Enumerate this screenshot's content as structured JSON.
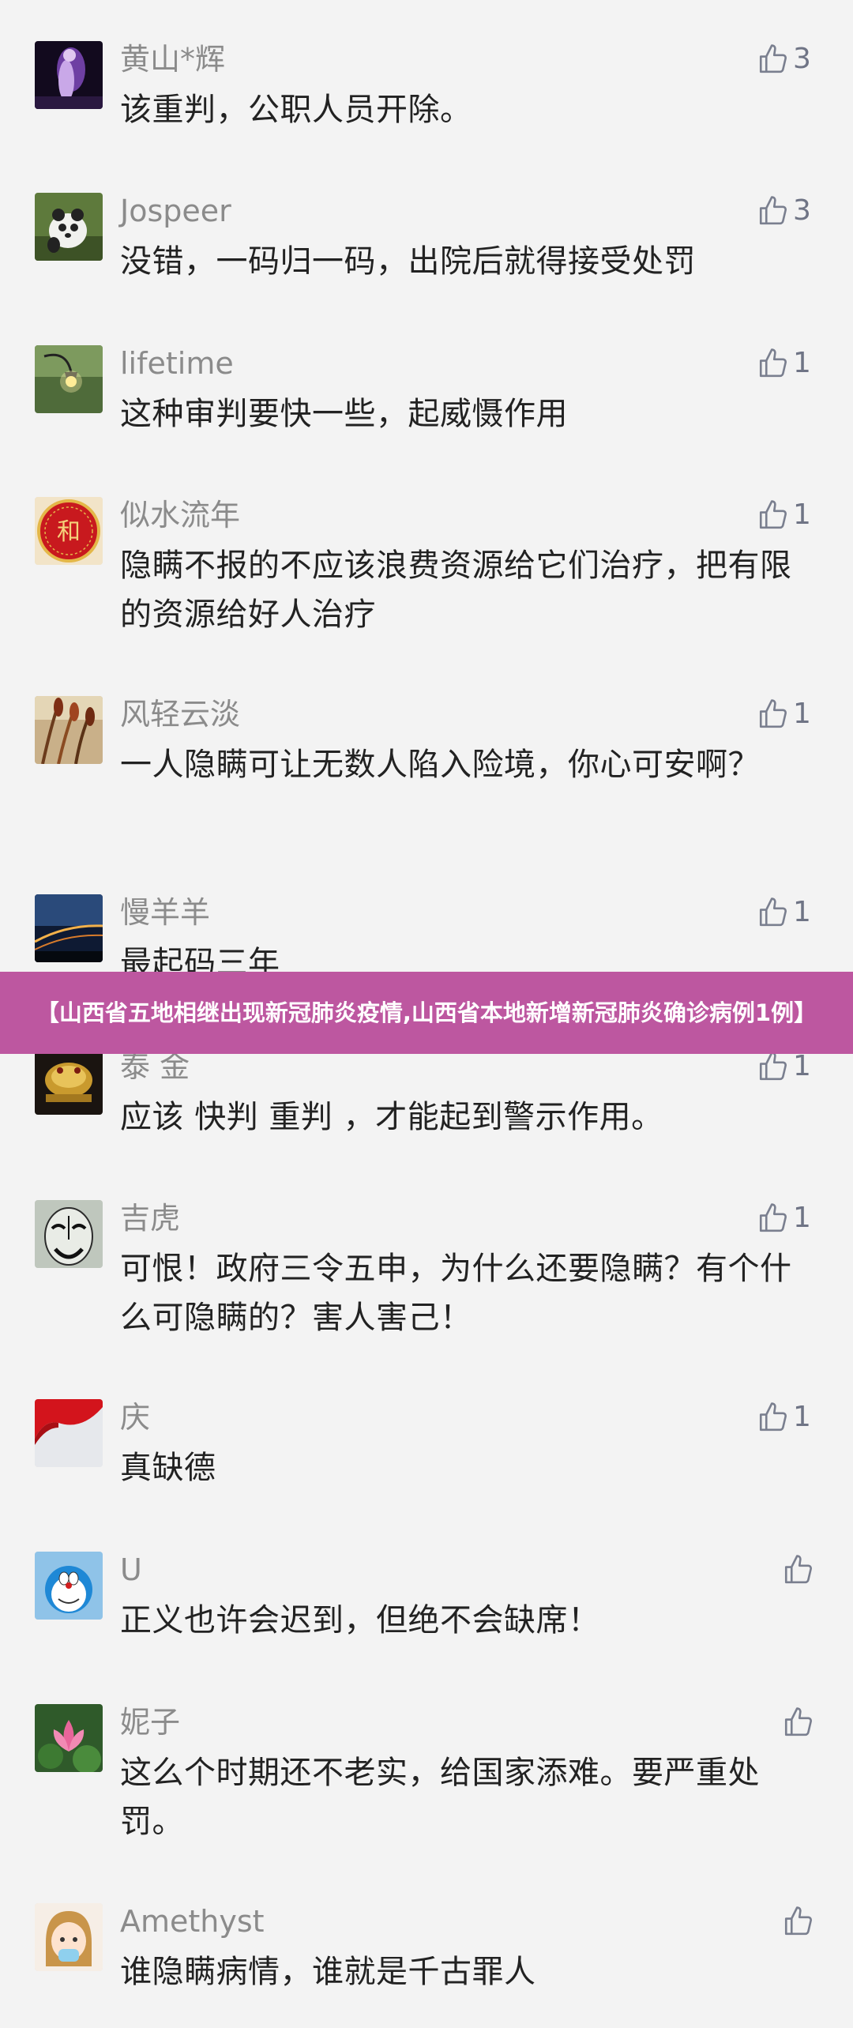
{
  "banner": {
    "title": "【山西省五地相继出现新冠肺炎疫情,山西省本地新增新冠肺炎确诊病例1例】"
  },
  "colors": {
    "background": "#f3f3f3",
    "banner": "#bd57a0",
    "username": "#8b8b8b",
    "comment_text": "#222222",
    "like_icon": "#7a7f8f"
  },
  "comments": [
    {
      "name": "黄山*辉",
      "text": "该重判，公职人员开除。",
      "likes": "3",
      "avatar_icon": "night-figure-avatar"
    },
    {
      "name": "Jospeer",
      "text": "没错，一码归一码，出院后就得接受处罚",
      "likes": "3",
      "avatar_icon": "panda-avatar"
    },
    {
      "name": "lifetime",
      "text": "这种审判要快一些，起威慑作用",
      "likes": "1",
      "avatar_icon": "street-lamp-avatar"
    },
    {
      "name": "似水流年",
      "text": "隐瞒不报的不应该浪费资源给它们治疗，把有限的资源给好人治疗",
      "likes": "1",
      "avatar_icon": "he-character-avatar"
    },
    {
      "name": "风轻云淡",
      "text": "一人隐瞒可让无数人陷入险境，你心可安啊？",
      "likes": "1",
      "avatar_icon": "reeds-avatar"
    },
    {
      "name": "慢羊羊",
      "text": "最起码三年",
      "likes": "1",
      "avatar_icon": "night-road-avatar"
    },
    {
      "name": "泰 金",
      "text": "应该 快判  重判 ，才能起到警示作用。",
      "likes": "1",
      "avatar_icon": "golden-toad-avatar"
    },
    {
      "name": "吉虎",
      "text": "可恨！政府三令五申，为什么还要隐瞒？有个什么可隐瞒的？害人害己！",
      "likes": "1",
      "avatar_icon": "opera-mask-avatar"
    },
    {
      "name": "庆",
      "text": "真缺德",
      "likes": "1",
      "avatar_icon": "red-flag-avatar"
    },
    {
      "name": "U",
      "text": "正义也许会迟到，但绝不会缺席！",
      "likes": "",
      "avatar_icon": "doraemon-avatar"
    },
    {
      "name": "妮子",
      "text": "这么个时期还不老实，给国家添难。要严重处罚。",
      "likes": "",
      "avatar_icon": "lotus-avatar"
    },
    {
      "name": "Amethyst",
      "text": "谁隐瞒病情，谁就是千古罪人",
      "likes": "",
      "avatar_icon": "cartoon-girl-avatar"
    }
  ]
}
